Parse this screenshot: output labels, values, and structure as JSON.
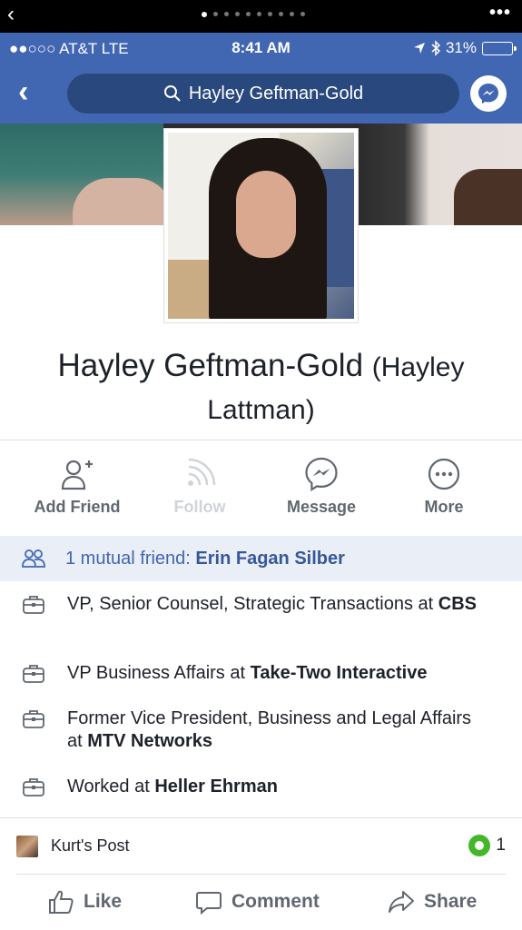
{
  "browser": {
    "back_glyph": "‹",
    "more_glyph": "•••",
    "page_dots": 10,
    "active_dot": 0
  },
  "status_bar": {
    "carrier": "●●○○○ AT&T  LTE",
    "time": "8:41 AM",
    "battery": "31%",
    "battery_level": 0.31
  },
  "header": {
    "back_glyph": "‹",
    "search_value": "Hayley Geftman-Gold",
    "brand_color": "#4267b2"
  },
  "profile": {
    "name": "Hayley Geftman-Gold",
    "alternate_name": "(Hayley Lattman)"
  },
  "actions": [
    {
      "label": "Add Friend",
      "icon": "add-friend-icon"
    },
    {
      "label": "Follow",
      "icon": "follow-icon"
    },
    {
      "label": "Message",
      "icon": "messenger-icon"
    },
    {
      "label": "More",
      "icon": "more-icon"
    }
  ],
  "mutual": {
    "prefix": "1 mutual friend: ",
    "friend": "Erin Fagan Silber"
  },
  "work": [
    {
      "text": "VP, Senior Counsel, Strategic Transactions at ",
      "org": "CBS"
    },
    {
      "text": "VP Business Affairs at ",
      "org": "Take-Two Interactive"
    },
    {
      "text": "Former Vice President, Business and Legal Affairs at ",
      "org": "MTV Networks"
    },
    {
      "text": "Worked at ",
      "org": "Heller Ehrman"
    }
  ],
  "post": {
    "title": "Kurt's Post",
    "comment_count": "1"
  },
  "footer": {
    "like": "Like",
    "comment": "Comment",
    "share": "Share"
  }
}
